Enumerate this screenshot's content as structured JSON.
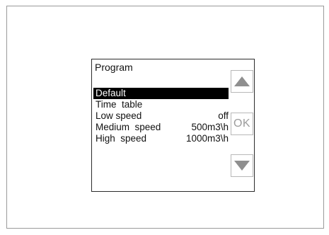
{
  "screen": {
    "title": "Program",
    "menu": [
      {
        "label": "Default",
        "value": "",
        "selected": true
      },
      {
        "label": "Time  table",
        "value": "",
        "selected": false
      },
      {
        "label": "Low speed",
        "value": "off",
        "selected": false
      },
      {
        "label": "Medium  speed",
        "value": "500m3\\h",
        "selected": false
      },
      {
        "label": "High  speed",
        "value": "1000m3\\h",
        "selected": false
      }
    ]
  },
  "buttons": {
    "up_icon": "triangle-up-icon",
    "ok_label": "OK",
    "down_icon": "triangle-down-icon"
  },
  "colors": {
    "selection_bg": "#000000",
    "selection_text": "#ffffff",
    "button_icon": "#8f8f8f"
  }
}
